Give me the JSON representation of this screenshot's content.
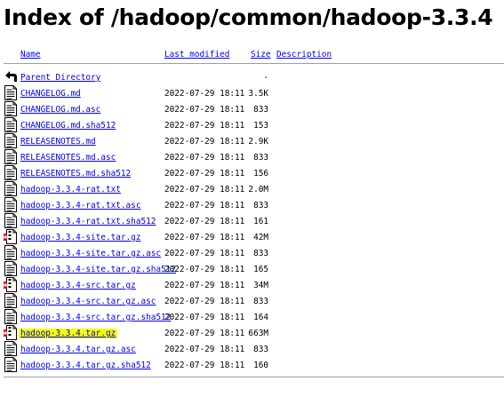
{
  "page": {
    "title": "Index of /hadoop/common/hadoop-3.3.4"
  },
  "table": {
    "headers": {
      "name": "Name",
      "last_modified": "Last modified",
      "size": "Size",
      "description": "Description"
    },
    "parent": {
      "label": "Parent Directory",
      "last_modified": "",
      "size": "-",
      "icon": "back-arrow-icon"
    },
    "rows": [
      {
        "name": "CHANGELOG.md",
        "last_modified": "2022-07-29 18:11",
        "size": "3.5K",
        "icon": "text-file-icon",
        "highlighted": false
      },
      {
        "name": "CHANGELOG.md.asc",
        "last_modified": "2022-07-29 18:11",
        "size": "833",
        "icon": "text-file-icon",
        "highlighted": false
      },
      {
        "name": "CHANGELOG.md.sha512",
        "last_modified": "2022-07-29 18:11",
        "size": "153",
        "icon": "text-file-icon",
        "highlighted": false
      },
      {
        "name": "RELEASENOTES.md",
        "last_modified": "2022-07-29 18:11",
        "size": "2.9K",
        "icon": "text-file-icon",
        "highlighted": false
      },
      {
        "name": "RELEASENOTES.md.asc",
        "last_modified": "2022-07-29 18:11",
        "size": "833",
        "icon": "text-file-icon",
        "highlighted": false
      },
      {
        "name": "RELEASENOTES.md.sha512",
        "last_modified": "2022-07-29 18:11",
        "size": "156",
        "icon": "text-file-icon",
        "highlighted": false
      },
      {
        "name": "hadoop-3.3.4-rat.txt",
        "last_modified": "2022-07-29 18:11",
        "size": "2.0M",
        "icon": "text-file-icon",
        "highlighted": false
      },
      {
        "name": "hadoop-3.3.4-rat.txt.asc",
        "last_modified": "2022-07-29 18:11",
        "size": "833",
        "icon": "text-file-icon",
        "highlighted": false
      },
      {
        "name": "hadoop-3.3.4-rat.txt.sha512",
        "last_modified": "2022-07-29 18:11",
        "size": "161",
        "icon": "text-file-icon",
        "highlighted": false
      },
      {
        "name": "hadoop-3.3.4-site.tar.gz",
        "last_modified": "2022-07-29 18:11",
        "size": "42M",
        "icon": "archive-icon",
        "highlighted": false
      },
      {
        "name": "hadoop-3.3.4-site.tar.gz.asc",
        "last_modified": "2022-07-29 18:11",
        "size": "833",
        "icon": "text-file-icon",
        "highlighted": false
      },
      {
        "name": "hadoop-3.3.4-site.tar.gz.sha512",
        "last_modified": "2022-07-29 18:11",
        "size": "165",
        "icon": "text-file-icon",
        "highlighted": false
      },
      {
        "name": "hadoop-3.3.4-src.tar.gz",
        "last_modified": "2022-07-29 18:11",
        "size": "34M",
        "icon": "archive-icon",
        "highlighted": false
      },
      {
        "name": "hadoop-3.3.4-src.tar.gz.asc",
        "last_modified": "2022-07-29 18:11",
        "size": "833",
        "icon": "text-file-icon",
        "highlighted": false
      },
      {
        "name": "hadoop-3.3.4-src.tar.gz.sha512",
        "last_modified": "2022-07-29 18:11",
        "size": "164",
        "icon": "text-file-icon",
        "highlighted": false
      },
      {
        "name": "hadoop-3.3.4.tar.gz",
        "last_modified": "2022-07-29 18:11",
        "size": "663M",
        "icon": "archive-icon",
        "highlighted": true
      },
      {
        "name": "hadoop-3.3.4.tar.gz.asc",
        "last_modified": "2022-07-29 18:11",
        "size": "833",
        "icon": "text-file-icon",
        "highlighted": false
      },
      {
        "name": "hadoop-3.3.4.tar.gz.sha512",
        "last_modified": "2022-07-29 18:11",
        "size": "160",
        "icon": "text-file-icon",
        "highlighted": false
      }
    ]
  },
  "colors": {
    "link": "#0000ee",
    "highlight": "#f7ff00",
    "separator": "#9e9e9e"
  }
}
